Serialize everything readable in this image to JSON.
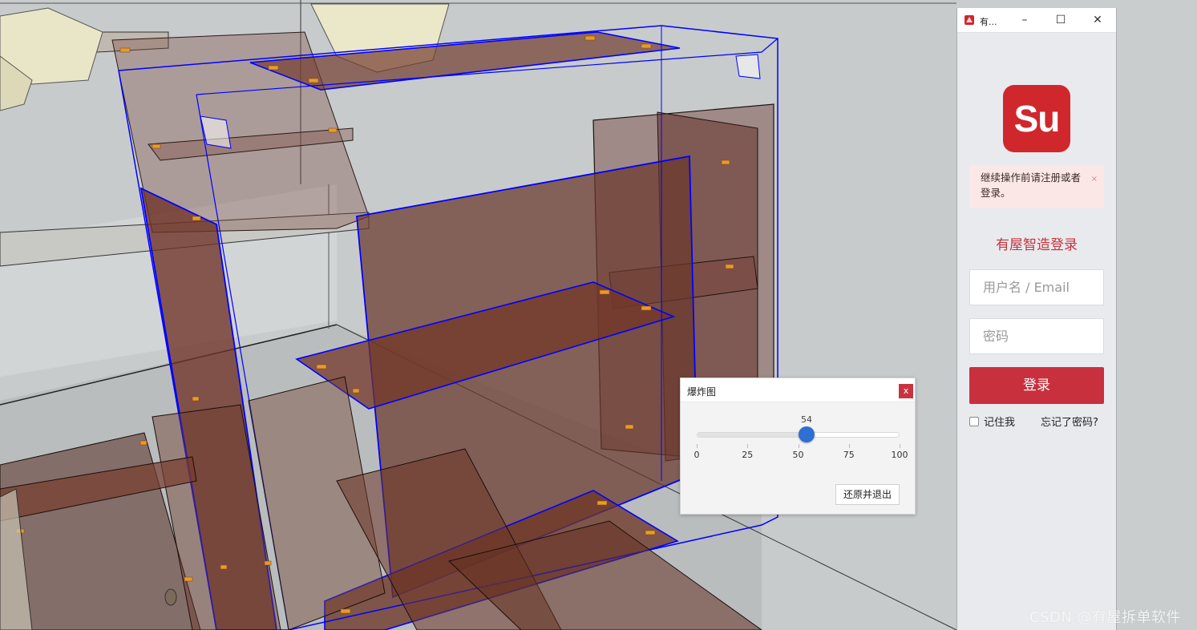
{
  "viewport": {
    "name": "sketchup-3d-viewport"
  },
  "explode_dialog": {
    "title": "爆炸图",
    "close_label": "x",
    "slider": {
      "value": 54,
      "min": 0,
      "max": 100,
      "value_label": "54"
    },
    "tick_labels": [
      "0",
      "25",
      "50",
      "75",
      "100"
    ],
    "restore_button": "还原并退出"
  },
  "login_window": {
    "title": "有...",
    "minimize": "–",
    "maximize": "☐",
    "close": "✕",
    "logo_text": "Su",
    "alert_text": "继续操作前请注册或者登录。",
    "alert_close": "×",
    "heading": "有屋智造登录",
    "username_placeholder": "用户名 / Email",
    "password_placeholder": "密码",
    "login_button": "登录",
    "remember_label": "记住我",
    "forgot_label": "忘记了密码?"
  },
  "watermark": "CSDN @有屋拆单软件",
  "colors": {
    "accent_red": "#c8303d",
    "slider_blue": "#2d6fd2",
    "selection_blue": "#0000ff",
    "wood": "#6b3a2a"
  }
}
